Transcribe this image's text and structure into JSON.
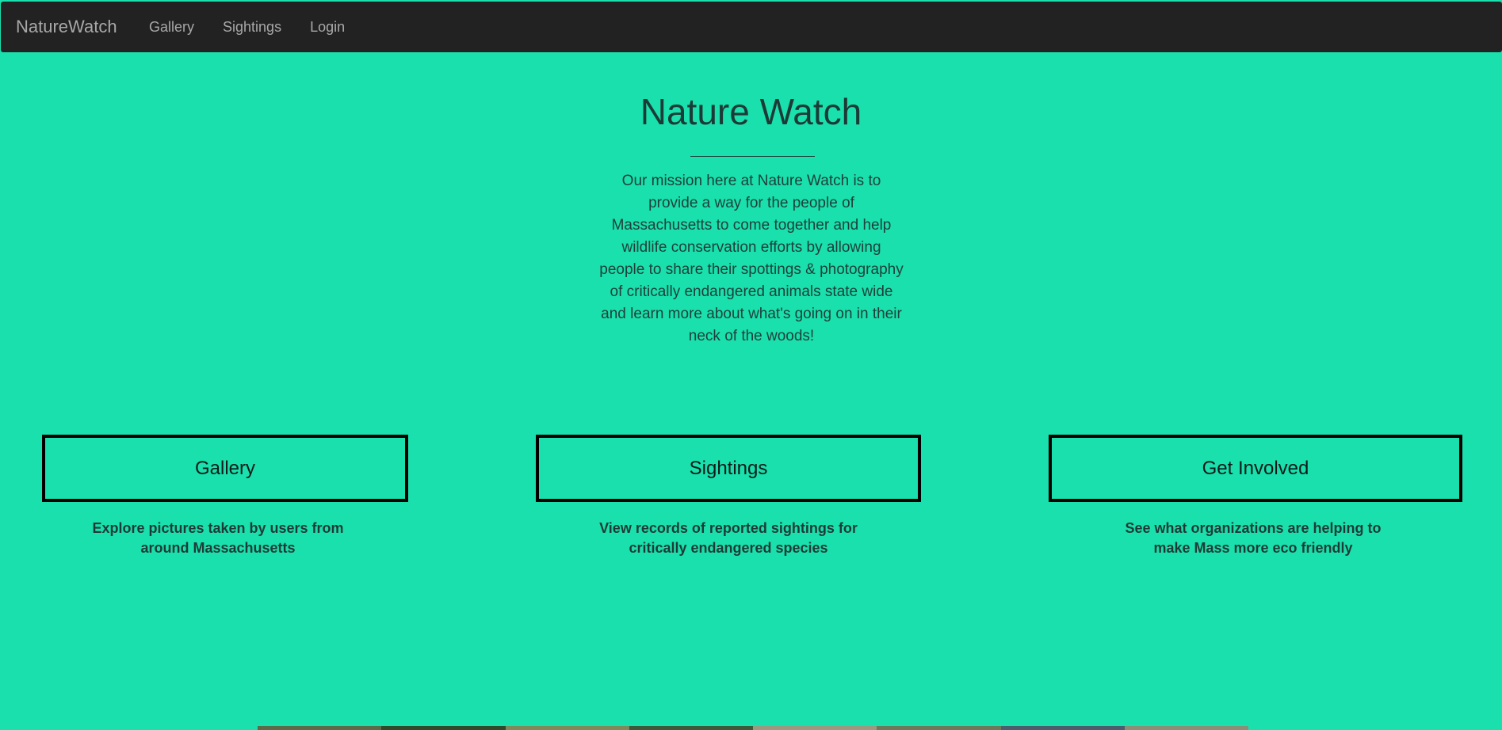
{
  "navbar": {
    "brand": "NatureWatch",
    "links": [
      {
        "label": "Gallery"
      },
      {
        "label": "Sightings"
      },
      {
        "label": "Login"
      }
    ]
  },
  "hero": {
    "title": "Nature Watch",
    "mission": "Our mission here at Nature Watch is to provide a way for the people of Massachusetts to come together and help wildlife conservation efforts by allowing people to share their spottings & photography of critically endangered animals state wide and learn more about what's going on in their neck of the woods!"
  },
  "features": [
    {
      "button": "Gallery",
      "description": "Explore pictures taken by users from around Massachusetts"
    },
    {
      "button": "Sightings",
      "description": "View records of reported sightings for critically endangered species"
    },
    {
      "button": "Get Involved",
      "description": "See what organizations are helping to make Mass more eco friendly"
    }
  ],
  "colors": {
    "background": "#19e0ac",
    "navbar": "#222222",
    "nav_text": "#a8a8a8",
    "heading_text": "#1c3b36",
    "button_border": "#000000"
  }
}
